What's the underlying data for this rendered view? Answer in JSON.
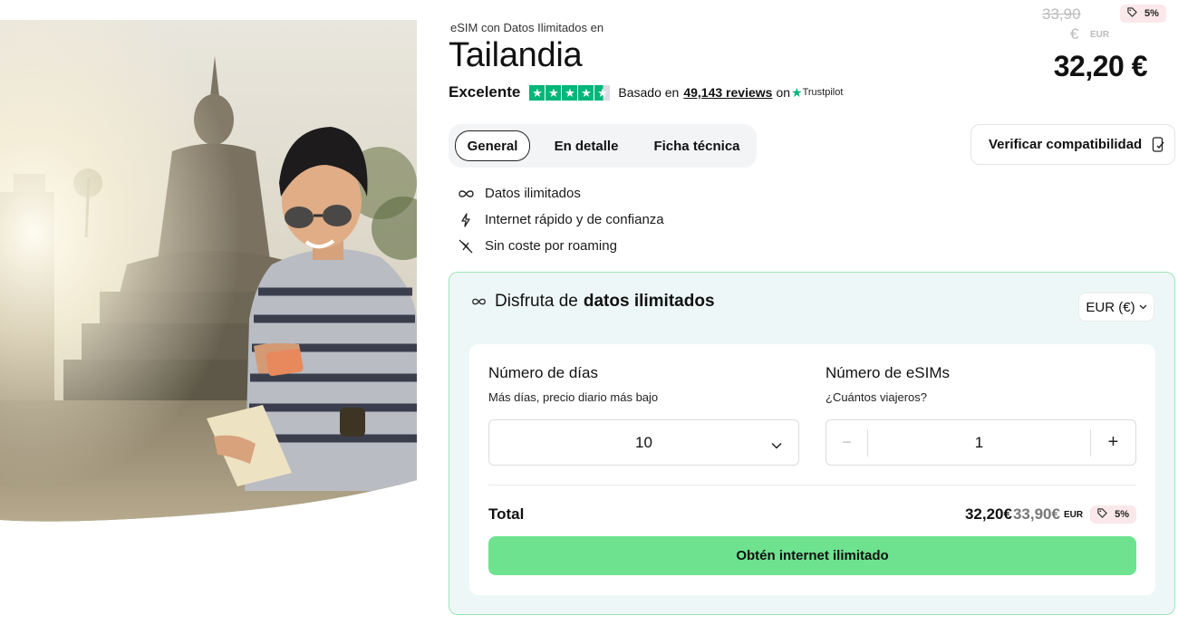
{
  "hero": {
    "image_description_icon": "traveler-photo"
  },
  "header": {
    "eyebrow": "eSIM con Datos Ilimitados en",
    "title": "Tailandia",
    "rating_word": "Excelente",
    "based_on": "Basado en",
    "reviews_link": "49,143 reviews",
    "on": "on",
    "trustpilot": "Trustpilot"
  },
  "price": {
    "old_value": "33,90",
    "old_currency_symbol": "€",
    "old_currency_code": "EUR",
    "discount": "5%",
    "current": "32,20 €"
  },
  "tabs": [
    {
      "label": "General",
      "active": true
    },
    {
      "label": "En detalle",
      "active": false
    },
    {
      "label": "Ficha técnica",
      "active": false
    }
  ],
  "verify_button": "Verificar compatibilidad",
  "features": [
    {
      "icon": "infinity-icon",
      "label": "Datos ilimitados"
    },
    {
      "icon": "lightning-icon",
      "label": "Internet rápido y de confianza"
    },
    {
      "icon": "no-roaming-icon",
      "label": "Sin coste por roaming"
    }
  ],
  "panel": {
    "heading_prefix": "Disfruta de",
    "heading_bold": "datos ilimitados",
    "currency_selector": "EUR (€)",
    "days_label": "Número de días",
    "days_hint": "Más días, precio diario más bajo",
    "days_value": "10",
    "esims_label": "Número de eSIMs",
    "esims_hint": "¿Cuántos viajeros?",
    "esims_value": "1",
    "minus": "−",
    "plus": "+",
    "total_label": "Total",
    "total_now": "32,20€",
    "total_old": "33,90€",
    "total_currency": "EUR",
    "total_discount": "5%",
    "cta": "Obtén internet ilimitado"
  },
  "colors": {
    "accent_green": "#6ee28f",
    "panel_bg": "#eef7f7",
    "panel_border": "#9ee4b8",
    "trustpilot_green": "#00b67a",
    "badge_bg": "#fbe8ea"
  }
}
